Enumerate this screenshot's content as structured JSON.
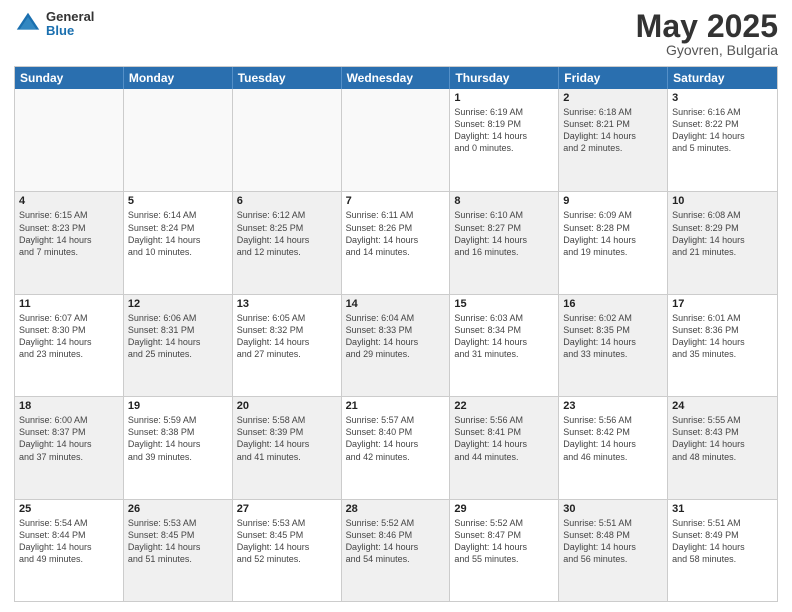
{
  "header": {
    "logo": {
      "general": "General",
      "blue": "Blue"
    },
    "title": "May 2025",
    "location": "Gyovren, Bulgaria"
  },
  "weekdays": [
    "Sunday",
    "Monday",
    "Tuesday",
    "Wednesday",
    "Thursday",
    "Friday",
    "Saturday"
  ],
  "rows": [
    [
      {
        "day": "",
        "info": "",
        "empty": true
      },
      {
        "day": "",
        "info": "",
        "empty": true
      },
      {
        "day": "",
        "info": "",
        "empty": true
      },
      {
        "day": "",
        "info": "",
        "empty": true
      },
      {
        "day": "1",
        "info": "Sunrise: 6:19 AM\nSunset: 8:19 PM\nDaylight: 14 hours\nand 0 minutes."
      },
      {
        "day": "2",
        "info": "Sunrise: 6:18 AM\nSunset: 8:21 PM\nDaylight: 14 hours\nand 2 minutes.",
        "shaded": true
      },
      {
        "day": "3",
        "info": "Sunrise: 6:16 AM\nSunset: 8:22 PM\nDaylight: 14 hours\nand 5 minutes."
      }
    ],
    [
      {
        "day": "4",
        "info": "Sunrise: 6:15 AM\nSunset: 8:23 PM\nDaylight: 14 hours\nand 7 minutes.",
        "shaded": true
      },
      {
        "day": "5",
        "info": "Sunrise: 6:14 AM\nSunset: 8:24 PM\nDaylight: 14 hours\nand 10 minutes."
      },
      {
        "day": "6",
        "info": "Sunrise: 6:12 AM\nSunset: 8:25 PM\nDaylight: 14 hours\nand 12 minutes.",
        "shaded": true
      },
      {
        "day": "7",
        "info": "Sunrise: 6:11 AM\nSunset: 8:26 PM\nDaylight: 14 hours\nand 14 minutes."
      },
      {
        "day": "8",
        "info": "Sunrise: 6:10 AM\nSunset: 8:27 PM\nDaylight: 14 hours\nand 16 minutes.",
        "shaded": true
      },
      {
        "day": "9",
        "info": "Sunrise: 6:09 AM\nSunset: 8:28 PM\nDaylight: 14 hours\nand 19 minutes."
      },
      {
        "day": "10",
        "info": "Sunrise: 6:08 AM\nSunset: 8:29 PM\nDaylight: 14 hours\nand 21 minutes.",
        "shaded": true
      }
    ],
    [
      {
        "day": "11",
        "info": "Sunrise: 6:07 AM\nSunset: 8:30 PM\nDaylight: 14 hours\nand 23 minutes."
      },
      {
        "day": "12",
        "info": "Sunrise: 6:06 AM\nSunset: 8:31 PM\nDaylight: 14 hours\nand 25 minutes.",
        "shaded": true
      },
      {
        "day": "13",
        "info": "Sunrise: 6:05 AM\nSunset: 8:32 PM\nDaylight: 14 hours\nand 27 minutes."
      },
      {
        "day": "14",
        "info": "Sunrise: 6:04 AM\nSunset: 8:33 PM\nDaylight: 14 hours\nand 29 minutes.",
        "shaded": true
      },
      {
        "day": "15",
        "info": "Sunrise: 6:03 AM\nSunset: 8:34 PM\nDaylight: 14 hours\nand 31 minutes."
      },
      {
        "day": "16",
        "info": "Sunrise: 6:02 AM\nSunset: 8:35 PM\nDaylight: 14 hours\nand 33 minutes.",
        "shaded": true
      },
      {
        "day": "17",
        "info": "Sunrise: 6:01 AM\nSunset: 8:36 PM\nDaylight: 14 hours\nand 35 minutes."
      }
    ],
    [
      {
        "day": "18",
        "info": "Sunrise: 6:00 AM\nSunset: 8:37 PM\nDaylight: 14 hours\nand 37 minutes.",
        "shaded": true
      },
      {
        "day": "19",
        "info": "Sunrise: 5:59 AM\nSunset: 8:38 PM\nDaylight: 14 hours\nand 39 minutes."
      },
      {
        "day": "20",
        "info": "Sunrise: 5:58 AM\nSunset: 8:39 PM\nDaylight: 14 hours\nand 41 minutes.",
        "shaded": true
      },
      {
        "day": "21",
        "info": "Sunrise: 5:57 AM\nSunset: 8:40 PM\nDaylight: 14 hours\nand 42 minutes."
      },
      {
        "day": "22",
        "info": "Sunrise: 5:56 AM\nSunset: 8:41 PM\nDaylight: 14 hours\nand 44 minutes.",
        "shaded": true
      },
      {
        "day": "23",
        "info": "Sunrise: 5:56 AM\nSunset: 8:42 PM\nDaylight: 14 hours\nand 46 minutes."
      },
      {
        "day": "24",
        "info": "Sunrise: 5:55 AM\nSunset: 8:43 PM\nDaylight: 14 hours\nand 48 minutes.",
        "shaded": true
      }
    ],
    [
      {
        "day": "25",
        "info": "Sunrise: 5:54 AM\nSunset: 8:44 PM\nDaylight: 14 hours\nand 49 minutes."
      },
      {
        "day": "26",
        "info": "Sunrise: 5:53 AM\nSunset: 8:45 PM\nDaylight: 14 hours\nand 51 minutes.",
        "shaded": true
      },
      {
        "day": "27",
        "info": "Sunrise: 5:53 AM\nSunset: 8:45 PM\nDaylight: 14 hours\nand 52 minutes."
      },
      {
        "day": "28",
        "info": "Sunrise: 5:52 AM\nSunset: 8:46 PM\nDaylight: 14 hours\nand 54 minutes.",
        "shaded": true
      },
      {
        "day": "29",
        "info": "Sunrise: 5:52 AM\nSunset: 8:47 PM\nDaylight: 14 hours\nand 55 minutes."
      },
      {
        "day": "30",
        "info": "Sunrise: 5:51 AM\nSunset: 8:48 PM\nDaylight: 14 hours\nand 56 minutes.",
        "shaded": true
      },
      {
        "day": "31",
        "info": "Sunrise: 5:51 AM\nSunset: 8:49 PM\nDaylight: 14 hours\nand 58 minutes."
      }
    ]
  ]
}
